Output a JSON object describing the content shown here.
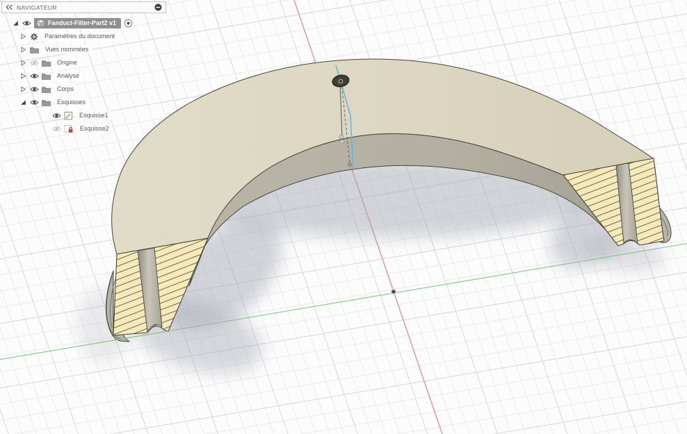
{
  "navigator": {
    "title": "NAVIGATEUR",
    "items": [
      {
        "label": "Fanduct-Filter-Part2 v1",
        "icon": "cube",
        "expander": "expanded",
        "eye": "visible",
        "selected": true,
        "trailing": "activate-radio",
        "depth": 0
      },
      {
        "label": "Paramètres du document",
        "icon": "gear",
        "expander": "collapsed",
        "eye": null,
        "selected": false,
        "trailing": null,
        "depth": 1
      },
      {
        "label": "Vues nommées",
        "icon": "folder",
        "expander": "collapsed",
        "eye": null,
        "selected": false,
        "trailing": null,
        "depth": 1
      },
      {
        "label": "Origine",
        "icon": "folder",
        "expander": "collapsed",
        "eye": "hidden",
        "selected": false,
        "trailing": null,
        "depth": 1
      },
      {
        "label": "Analyse",
        "icon": "folder",
        "expander": "collapsed",
        "eye": "visible",
        "selected": false,
        "trailing": null,
        "depth": 1
      },
      {
        "label": "Corps",
        "icon": "folder",
        "expander": "collapsed",
        "eye": "visible",
        "selected": false,
        "trailing": null,
        "depth": 1
      },
      {
        "label": "Esquisses",
        "icon": "folder",
        "expander": "expanded",
        "eye": "visible",
        "selected": false,
        "trailing": null,
        "depth": 1
      },
      {
        "label": "Esquisse1",
        "icon": "sketch",
        "expander": null,
        "eye": "visible",
        "selected": false,
        "trailing": null,
        "depth": 2
      },
      {
        "label": "Esquisse2",
        "icon": "sketch-locked",
        "expander": null,
        "eye": "hidden",
        "selected": false,
        "trailing": null,
        "depth": 2
      }
    ]
  },
  "viewport": {
    "grid": "on",
    "axes_visible": [
      "red-axis",
      "green-axis"
    ],
    "overlays": [
      "hole-sketch",
      "dashed-construction-line",
      "blue-sketch-line",
      "origin-point"
    ]
  },
  "colors": {
    "background": "#fcfcfc",
    "grid_minor": "#ececec",
    "grid_major": "#dbdbdb",
    "axis_red": "#e58a8a",
    "axis_green": "#8bc98b",
    "outline": "#45443a",
    "body_top": "#dcd6c2",
    "body_inner": "#b3b0a2",
    "section_fill": "#f6e9ba",
    "hatch_line": "#3a392e",
    "groove": "#b0ada1",
    "flange": "#b7b4ab",
    "shadow": "#a6aab5",
    "sketch_blue": "#5ab4e0",
    "sketch_gray": "#55544a",
    "selection": "#8f8f8f",
    "panel_bg": "#fafafa",
    "panel_border": "#c2c2c2",
    "text": "#5a5a5a"
  }
}
